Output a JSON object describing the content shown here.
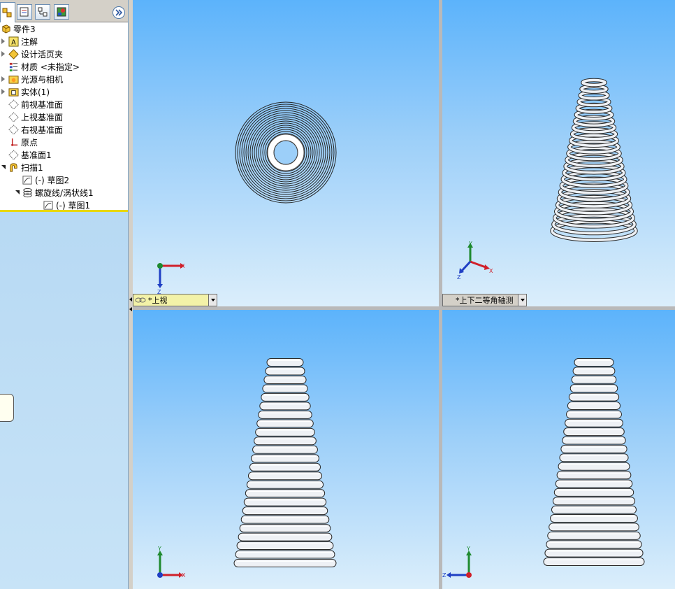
{
  "feature_tree": {
    "tabs": [
      {
        "name": "featuremanager-tab",
        "icon": "feature-tree-icon"
      },
      {
        "name": "propertymanager-tab",
        "icon": "property-sheet-icon"
      },
      {
        "name": "configurationmanager-tab",
        "icon": "configuration-icon"
      },
      {
        "name": "displaymanager-tab",
        "icon": "appearance-icon"
      }
    ],
    "root": "零件3",
    "items": [
      {
        "label": "注解",
        "icon": "annotation-icon"
      },
      {
        "label": "设计活页夹",
        "icon": "design-binder-icon"
      },
      {
        "label": "材质 <未指定>",
        "icon": "material-icon"
      },
      {
        "label": "光源与相机",
        "icon": "lights-camera-icon"
      },
      {
        "label": "实体(1)",
        "icon": "solid-body-icon"
      },
      {
        "label": "前视基准面",
        "icon": "plane-icon"
      },
      {
        "label": "上视基准面",
        "icon": "plane-icon"
      },
      {
        "label": "右视基准面",
        "icon": "plane-icon"
      },
      {
        "label": "原点",
        "icon": "origin-icon"
      },
      {
        "label": "基准面1",
        "icon": "plane-icon"
      },
      {
        "label": "扫描1",
        "icon": "sweep-icon"
      },
      {
        "label": "(-) 草图2",
        "icon": "sketch-icon"
      },
      {
        "label": "螺旋线/涡状线1",
        "icon": "helix-icon"
      },
      {
        "label": "(-) 草图1",
        "icon": "sketch-icon"
      }
    ]
  },
  "viewports": {
    "top": {
      "view_name": "*上视",
      "axes": [
        "X",
        "Z"
      ]
    },
    "iso": {
      "view_name": "*上下二等角轴测",
      "axes": [
        "Y",
        "X",
        "Z"
      ]
    },
    "front": {
      "axes": [
        "Y",
        "X"
      ]
    },
    "right": {
      "axes": [
        "Y",
        "Z"
      ]
    }
  },
  "colors": {
    "viewport_top": "#5cb3fb",
    "viewport_bottom": "#dbeefb",
    "axis_x": "#d0202a",
    "axis_y": "#1f8a2f",
    "axis_z": "#1f3fc4",
    "tree_underline": "#e9d700"
  }
}
